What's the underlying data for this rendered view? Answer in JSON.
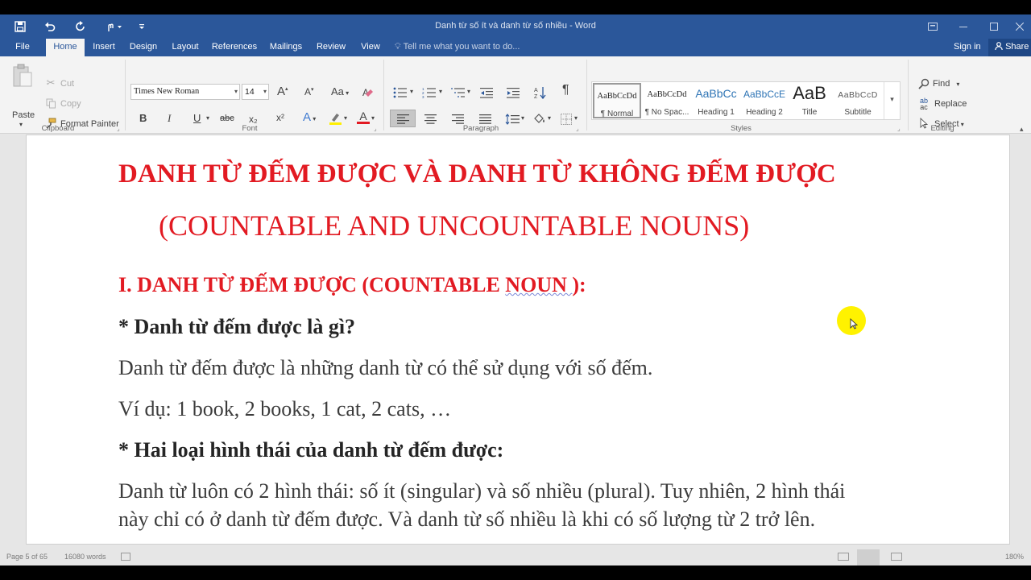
{
  "window": {
    "title": "Danh từ số ít và danh từ số nhiều - Word"
  },
  "quick_access": {
    "icons": [
      "save-icon",
      "undo-icon",
      "redo-icon",
      "touch-mode-icon",
      "customize-icon"
    ]
  },
  "tabs": [
    {
      "label": "File"
    },
    {
      "label": "Home"
    },
    {
      "label": "Insert"
    },
    {
      "label": "Design"
    },
    {
      "label": "Layout"
    },
    {
      "label": "References"
    },
    {
      "label": "Mailings"
    },
    {
      "label": "Review"
    },
    {
      "label": "View"
    }
  ],
  "tell_me": "Tell me what you want to do...",
  "sign_in": "Sign in",
  "share": "Share",
  "clipboard": {
    "paste": "Paste",
    "cut": "Cut",
    "copy": "Copy",
    "format_painter": "Format Painter",
    "label": "Clipboard"
  },
  "font": {
    "name": "Times New Roman",
    "size": "14",
    "label": "Font",
    "bold": "B",
    "italic": "I",
    "underline": "U",
    "strike": "abc",
    "subscript": "x₂",
    "superscript": "x²",
    "grow": "A",
    "shrink": "A",
    "case": "Aa",
    "text_effects": "A",
    "font_color": "A"
  },
  "paragraph": {
    "label": "Paragraph",
    "pilcrow": "¶"
  },
  "styles": {
    "label": "Styles",
    "items": [
      {
        "preview": "AaBbCcDd",
        "name": "¶ Normal"
      },
      {
        "preview": "AaBbCcDd",
        "name": "¶ No Spac..."
      },
      {
        "preview": "AaBbCc",
        "name": "Heading 1"
      },
      {
        "preview": "AaBbCcE",
        "name": "Heading 2"
      },
      {
        "preview": "AaB",
        "name": "Title"
      },
      {
        "preview": "AaBbCcD",
        "name": "Subtitle"
      }
    ]
  },
  "editing": {
    "label": "Editing",
    "find": "Find",
    "replace": "Replace",
    "select": "Select"
  },
  "document": {
    "title_line1": "DANH TỪ ĐẾM ĐƯỢC VÀ DANH TỪ KHÔNG ĐẾM ĐƯỢC",
    "title_line2": "(COUNTABLE AND UNCOUNTABLE NOUNS)",
    "heading1_a": "I. DANH TỪ ĐẾM ĐƯỢC (COUNTABLE ",
    "heading1_b": "NOUN ",
    "heading1_c": "):",
    "q1": "* Danh từ đếm được là gì?",
    "p1": "Danh từ đếm được là những danh từ có thể sử dụng với số đếm.",
    "p2": "Ví dụ: 1 book, 2 books, 1 cat, 2 cats, …",
    "q2": "* Hai loại hình thái của danh từ đếm được:",
    "p3_line1": "Danh từ luôn có 2 hình thái: số ít (singular) và số nhiều (plural). Tuy nhiên, 2 hình thái",
    "p3_line2": "này chỉ có ở danh từ đếm được. Và danh từ số nhiều là khi có số lượng từ 2 trở lên."
  },
  "status": {
    "page": "Page 5 of 65",
    "words": "16080 words",
    "zoom": "180%"
  },
  "colors": {
    "word_blue": "#2b579a",
    "heading_red": "#e21a22",
    "highlight_yellow": "#fff200"
  }
}
